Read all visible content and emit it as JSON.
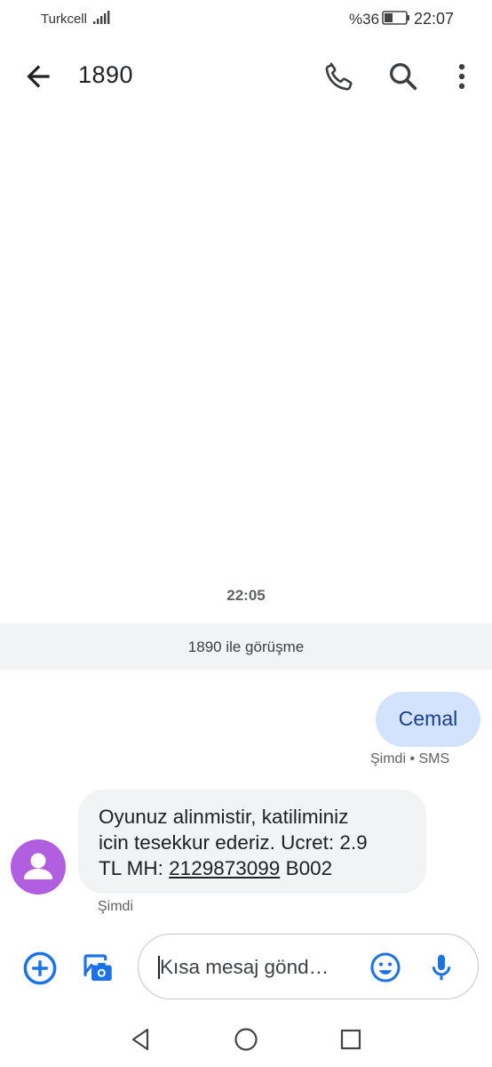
{
  "status_bar": {
    "carrier": "Turkcell",
    "battery_percent": "%36",
    "time": "22:07",
    "icons": [
      "signal-icon",
      "battery-icon"
    ]
  },
  "app_bar": {
    "title": "1890",
    "icons": [
      "back-arrow-icon",
      "phone-icon",
      "search-icon",
      "more-vert-icon"
    ]
  },
  "conversation": {
    "time_divider": "22:05",
    "header": "1890 ile görüşme",
    "messages": [
      {
        "direction": "outgoing",
        "text": "Cemal",
        "meta": "Şimdi • SMS"
      },
      {
        "direction": "incoming",
        "text_line1": "Oyunuz alinmistir, katiliminiz",
        "text_line2": "icin tesekkur ederiz. Ucret: 2.9",
        "text_line3_prefix": "TL MH: ",
        "text_line3_link": "2129873099",
        "text_line3_suffix": " B002",
        "meta": "Şimdi"
      }
    ]
  },
  "compose": {
    "placeholder": "Kısa mesaj gönd…",
    "icons": [
      "add-circle-icon",
      "gallery-camera-icon",
      "emoji-icon",
      "mic-icon"
    ]
  },
  "nav_bar": {
    "icons": [
      "nav-back-icon",
      "nav-home-icon",
      "nav-recents-icon"
    ]
  },
  "colors": {
    "accent": "#1a73e8",
    "outgoing_bubble": "#d3e3fd",
    "incoming_bubble": "#f1f3f4",
    "avatar": "#b15ee0"
  }
}
